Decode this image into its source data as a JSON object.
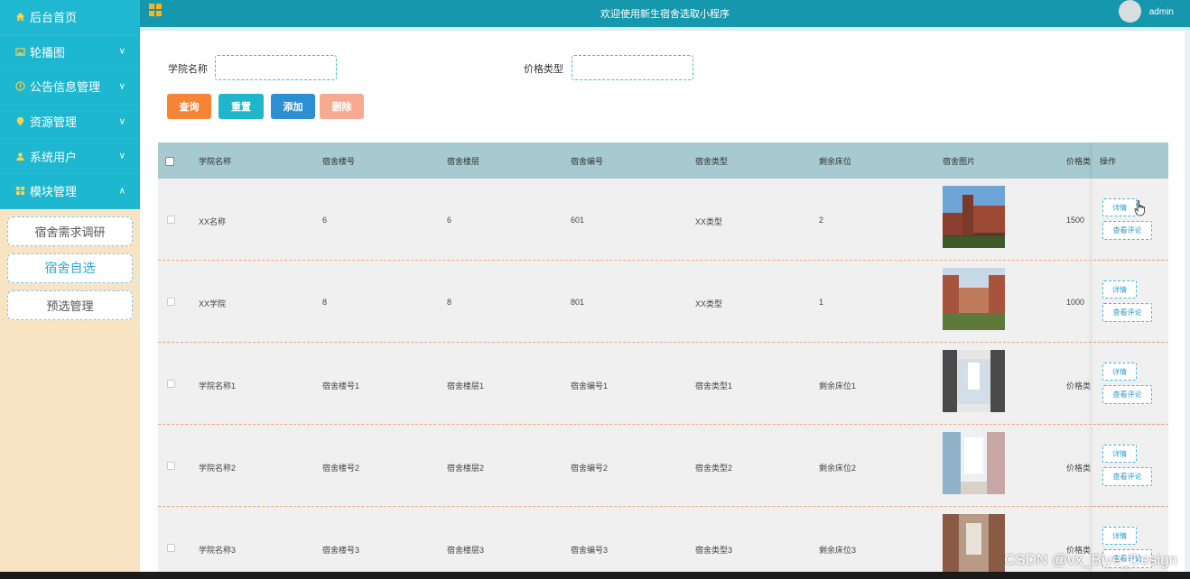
{
  "sidebar": {
    "menu": [
      {
        "label": "后台首页",
        "icon": "home-icon",
        "chevron": ""
      },
      {
        "label": "轮播图",
        "icon": "image-icon",
        "chevron": "∨"
      },
      {
        "label": "公告信息管理",
        "icon": "info-icon",
        "chevron": "∨"
      },
      {
        "label": "资源管理",
        "icon": "pin-icon",
        "chevron": "∨"
      },
      {
        "label": "系统用户",
        "icon": "user-icon",
        "chevron": "∨"
      },
      {
        "label": "模块管理",
        "icon": "grid-icon",
        "chevron": "∧"
      }
    ],
    "submenu": [
      {
        "label": "宿舍需求调研"
      },
      {
        "label": "宿舍自选"
      },
      {
        "label": "预选管理"
      }
    ]
  },
  "header": {
    "title": "欢迎使用新生宿舍选取小程序",
    "user": "admin"
  },
  "search": {
    "field1_label": "学院名称",
    "field2_label": "价格类型"
  },
  "buttons": {
    "query": "查询",
    "reset": "重置",
    "add": "添加",
    "delete": "删除"
  },
  "colors": {
    "query": "#f58535",
    "reset": "#1fb5cb",
    "add": "#2b8fd1",
    "delete": "#f8a991"
  },
  "table": {
    "columns": [
      "学院名称",
      "宿舍楼号",
      "宿舍楼层",
      "宿舍编号",
      "宿舍类型",
      "剩余床位",
      "宿舍图片",
      "价格类",
      "操作"
    ],
    "rows": [
      {
        "college": "XX名称",
        "building": "6",
        "floor": "6",
        "room": "601",
        "type": "XX类型",
        "beds": "2",
        "price": "1500"
      },
      {
        "college": "XX学院",
        "building": "8",
        "floor": "8",
        "room": "801",
        "type": "XX类型",
        "beds": "1",
        "price": "1000"
      },
      {
        "college": "学院名称1",
        "building": "宿舍楼号1",
        "floor": "宿舍楼层1",
        "room": "宿舍编号1",
        "type": "宿舍类型1",
        "beds": "剩余床位1",
        "price": "价格类"
      },
      {
        "college": "学院名称2",
        "building": "宿舍楼号2",
        "floor": "宿舍楼层2",
        "room": "宿舍编号2",
        "type": "宿舍类型2",
        "beds": "剩余床位2",
        "price": "价格类"
      },
      {
        "college": "学院名称3",
        "building": "宿舍楼号3",
        "floor": "宿舍楼层3",
        "room": "宿舍编号3",
        "type": "宿舍类型3",
        "beds": "剩余床位3",
        "price": "价格类"
      }
    ],
    "detail_label": "详情",
    "review_label": "查看评论"
  },
  "watermark": "CSDN @vx_Biye_Design"
}
